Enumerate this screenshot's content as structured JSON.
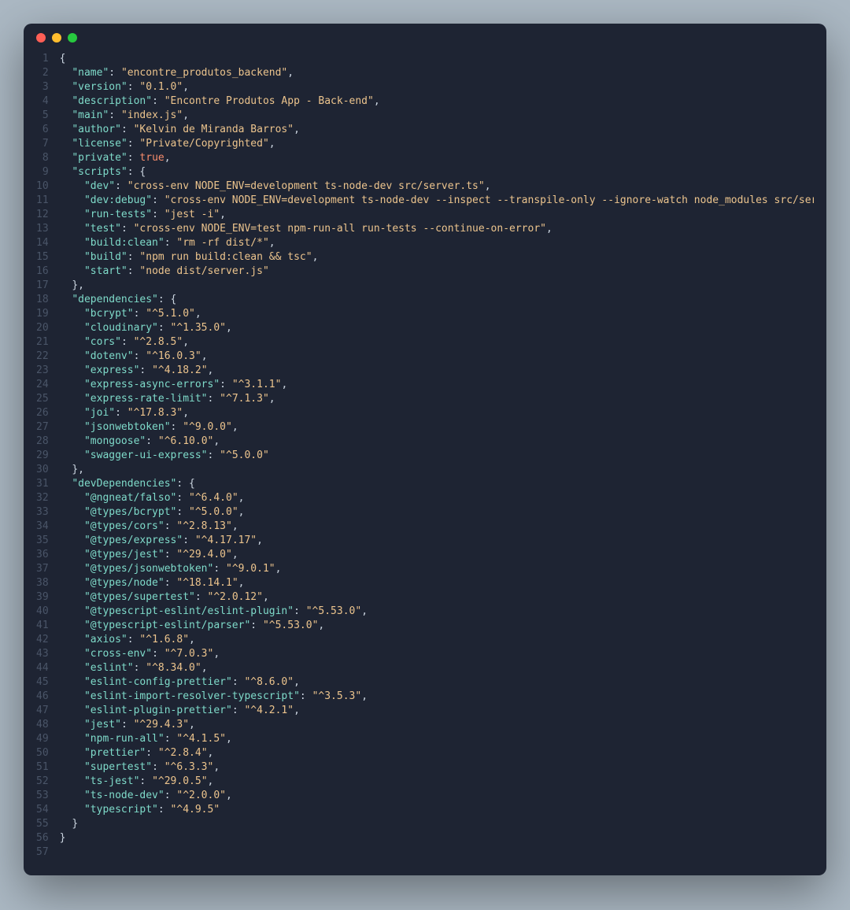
{
  "window": {
    "dots": [
      "red",
      "yellow",
      "green"
    ]
  },
  "colors": {
    "bg": "#1e2433",
    "gutter": "#4a5568",
    "key": "#7fdbca",
    "string": "#ecc48d",
    "num": "#f78c6c",
    "punct": "#cbd5e0"
  },
  "json_content": {
    "name": "encontre_produtos_backend",
    "version": "0.1.0",
    "description": "Encontre Produtos App - Back-end",
    "main": "index.js",
    "author": "Kelvin de Miranda Barros",
    "license": "Private/Copyrighted",
    "private": true,
    "scripts": {
      "dev": "cross-env NODE_ENV=development ts-node-dev src/server.ts",
      "dev:debug": "cross-env NODE_ENV=development ts-node-dev --inspect --transpile-only --ignore-watch node_modules src/server.ts",
      "run-tests": "jest -i",
      "test": "cross-env NODE_ENV=test npm-run-all run-tests --continue-on-error",
      "build:clean": "rm -rf dist/*",
      "build": "npm run build:clean && tsc",
      "start": "node dist/server.js"
    },
    "dependencies": {
      "bcrypt": "^5.1.0",
      "cloudinary": "^1.35.0",
      "cors": "^2.8.5",
      "dotenv": "^16.0.3",
      "express": "^4.18.2",
      "express-async-errors": "^3.1.1",
      "express-rate-limit": "^7.1.3",
      "joi": "^17.8.3",
      "jsonwebtoken": "^9.0.0",
      "mongoose": "^6.10.0",
      "swagger-ui-express": "^5.0.0"
    },
    "devDependencies": {
      "@ngneat/falso": "^6.4.0",
      "@types/bcrypt": "^5.0.0",
      "@types/cors": "^2.8.13",
      "@types/express": "^4.17.17",
      "@types/jest": "^29.4.0",
      "@types/jsonwebtoken": "^9.0.1",
      "@types/node": "^18.14.1",
      "@types/supertest": "^2.0.12",
      "@typescript-eslint/eslint-plugin": "^5.53.0",
      "@typescript-eslint/parser": "^5.53.0",
      "axios": "^1.6.8",
      "cross-env": "^7.0.3",
      "eslint": "^8.34.0",
      "eslint-config-prettier": "^8.6.0",
      "eslint-import-resolver-typescript": "^3.5.3",
      "eslint-plugin-prettier": "^4.2.1",
      "jest": "^29.4.3",
      "npm-run-all": "^4.1.5",
      "prettier": "^2.8.4",
      "supertest": "^6.3.3",
      "ts-jest": "^29.0.5",
      "ts-node-dev": "^2.0.0",
      "typescript": "^4.9.5"
    }
  },
  "total_lines": 57
}
